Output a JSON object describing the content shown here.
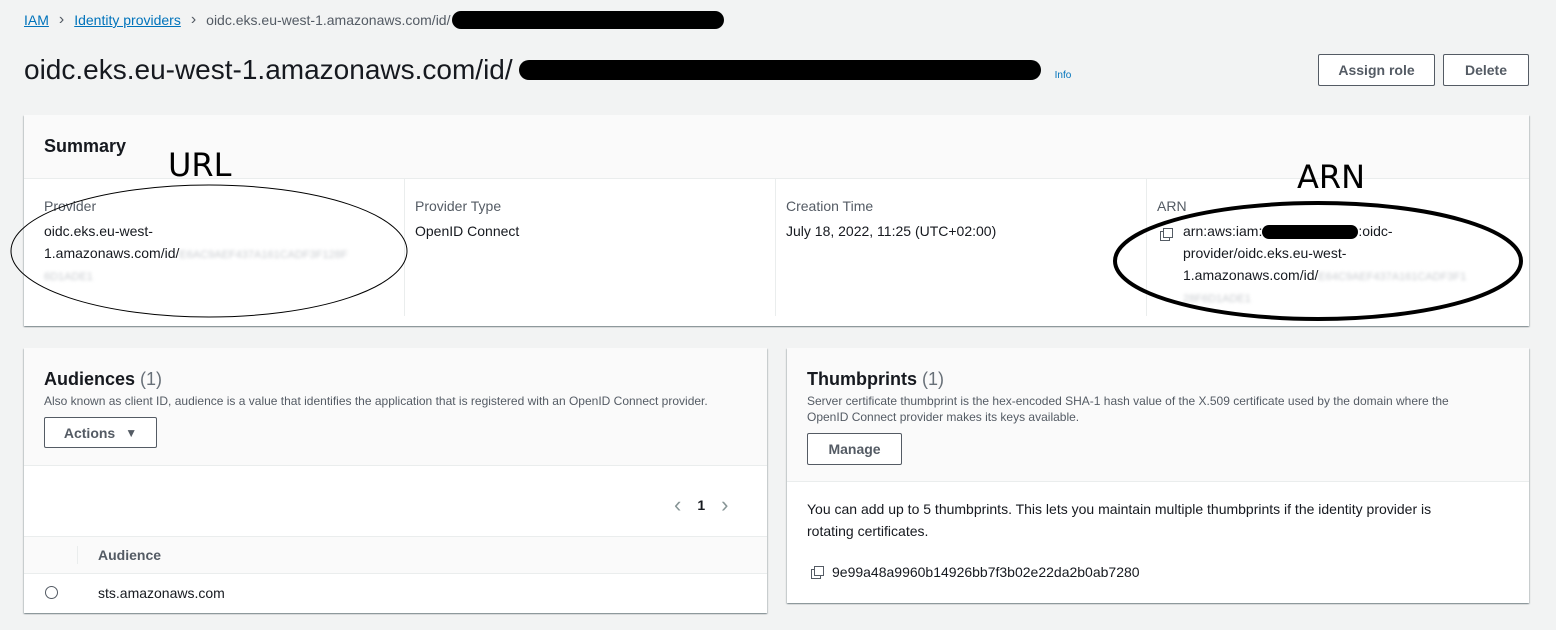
{
  "breadcrumb": {
    "root": "IAM",
    "section": "Identity providers",
    "current": "oidc.eks.eu-west-1.amazonaws.com/id/"
  },
  "header": {
    "title": "oidc.eks.eu-west-1.amazonaws.com/id/",
    "info": "Info",
    "assign_role": "Assign role",
    "delete": "Delete"
  },
  "summary": {
    "heading": "Summary",
    "provider_label": "Provider",
    "provider_value_1": "oidc.eks.eu-west-",
    "provider_value_2": "1.amazonaws.com/id/",
    "provider_blur_1": "E6AC9AEF437A161CADF3F128F",
    "provider_blur_2": "6D1ADE1",
    "type_label": "Provider Type",
    "type_value": "OpenID Connect",
    "time_label": "Creation Time",
    "time_value": "July 18, 2022, 11:25 (UTC+02:00)",
    "arn_label": "ARN",
    "arn_value_1a": "arn:aws:iam:",
    "arn_value_1b": ":oidc-",
    "arn_value_2": "provider/oidc.eks.eu-west-",
    "arn_value_3": "1.amazonaws.com/id/",
    "arn_blur_1": "E64C9AEF437A161CADF3F1",
    "arn_blur_2": "28F6D1ADE1"
  },
  "annotations": {
    "url": "URL",
    "arn": "ARN"
  },
  "audiences": {
    "heading": "Audiences",
    "count": "(1)",
    "description": "Also known as client ID, audience is a value that identifies the application that is registered with an OpenID Connect provider.",
    "actions": "Actions",
    "page": "1",
    "column": "Audience",
    "rows": [
      "sts.amazonaws.com"
    ]
  },
  "thumbprints": {
    "heading": "Thumbprints",
    "count": "(1)",
    "description_1": "Server certificate thumbprint is the hex-encoded SHA-1 hash value of the X.509 certificate used by the domain where the",
    "description_2": "OpenID Connect provider makes its keys available.",
    "manage": "Manage",
    "note_1": "You can add up to 5 thumbprints. This lets you maintain multiple thumbprints if the identity provider is",
    "note_2": "rotating certificates.",
    "value": "9e99a48a9960b14926bb7f3b02e22da2b0ab7280"
  },
  "colors": {
    "link": "#0073bb",
    "text": "#16191f",
    "secondary": "#545b64",
    "background": "#f2f3f3"
  }
}
